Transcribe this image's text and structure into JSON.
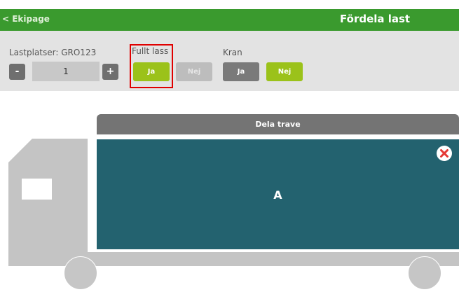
{
  "header": {
    "back_label": "< Ekipage",
    "title": "Fördela last"
  },
  "lastplatser": {
    "label": "Lastplatser: GRO123",
    "minus_label": "-",
    "value": "1",
    "plus_label": "+"
  },
  "fullt_lass": {
    "label": "Fullt lass",
    "yes_label": "Ja",
    "no_label": "Nej",
    "selected": "Ja"
  },
  "kran": {
    "label": "Kran",
    "yes_label": "Ja",
    "no_label": "Nej",
    "selected": "Nej"
  },
  "load": {
    "split_button_label": "Dela trave",
    "stack_label": "A"
  },
  "colors": {
    "header_green": "#3a9a2e",
    "selected_green": "#9bc21a",
    "cargo_teal": "#23626f",
    "highlight_red": "#e00000"
  }
}
